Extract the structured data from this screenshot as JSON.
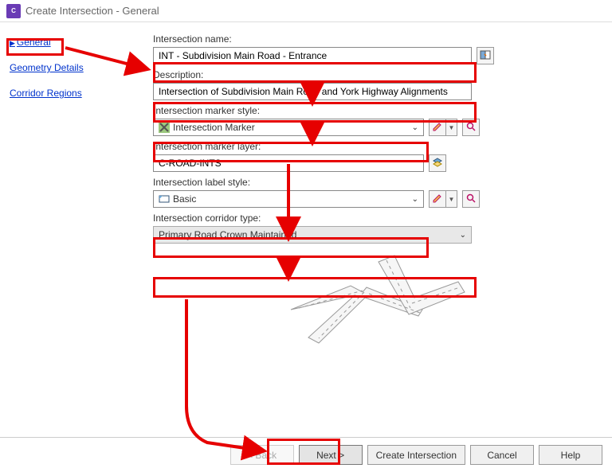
{
  "window": {
    "title": "Create Intersection - General",
    "app_icon_label": "C"
  },
  "sidebar": {
    "items": [
      {
        "label": "General",
        "active": true
      },
      {
        "label": "Geometry Details",
        "active": false
      },
      {
        "label": "Corridor Regions",
        "active": false
      }
    ]
  },
  "form": {
    "name": {
      "label": "Intersection name:",
      "value": "INT - Subdivision Main Road - Entrance"
    },
    "description": {
      "label": "Description:",
      "value": "Intersection of Subdivision Main Road and York Highway Alignments"
    },
    "marker_style": {
      "label": "Intersection marker style:",
      "value": "Intersection Marker"
    },
    "marker_layer": {
      "label": "Intersection marker layer:",
      "value": "C-ROAD-INTS"
    },
    "label_style": {
      "label": "Intersection label style:",
      "value": "Basic"
    },
    "corridor_type": {
      "label": "Intersection corridor type:",
      "value": "Primary Road Crown Maintained"
    }
  },
  "footer": {
    "back": "< Back",
    "next": "Next >",
    "create": "Create Intersection",
    "cancel": "Cancel",
    "help": "Help"
  },
  "icons": {
    "name_template": "name-template-icon",
    "style_pencil": "edit-style-icon",
    "style_dropdown": "▼",
    "style_preview": "preview-icon",
    "layer": "layer-icon"
  }
}
